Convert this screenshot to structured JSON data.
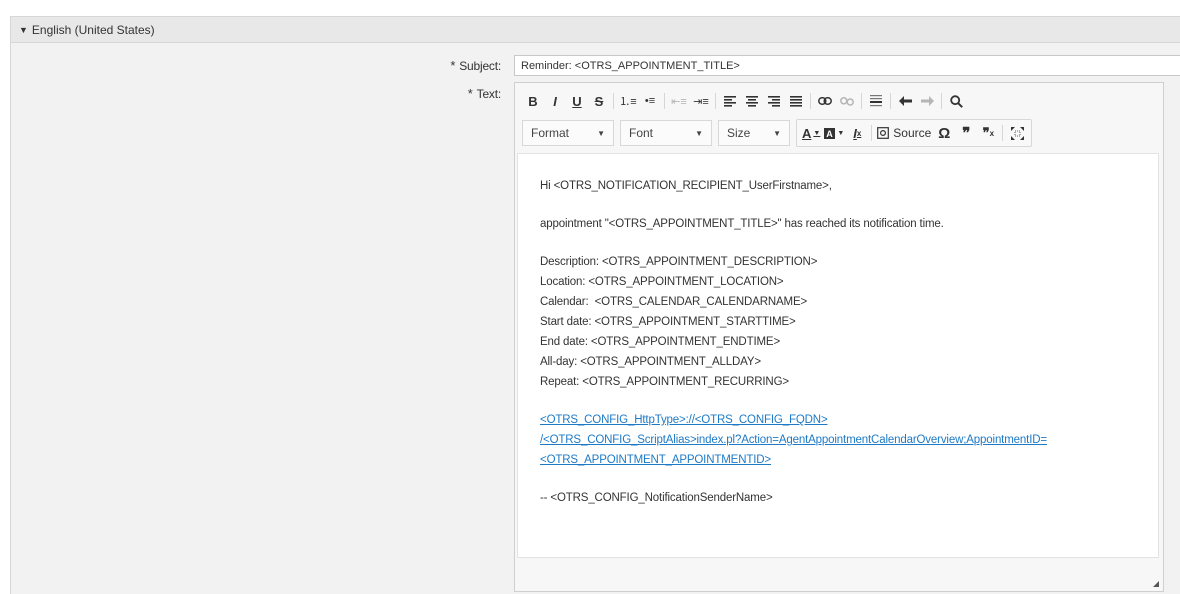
{
  "panel": {
    "title": "English (United States)"
  },
  "subject": {
    "label": "Subject:",
    "required_mark": "*",
    "value": "Reminder: <OTRS_APPOINTMENT_TITLE>"
  },
  "text_field": {
    "label": "Text:",
    "required_mark": "*"
  },
  "toolbar": {
    "format_label": "Format",
    "font_label": "Font",
    "size_label": "Size",
    "source_label": "Source",
    "icons": [
      "bold",
      "italic",
      "underline",
      "strikethrough",
      "numbered-list",
      "bulleted-list",
      "decrease-indent",
      "increase-indent",
      "align-left",
      "align-center",
      "align-right",
      "justify",
      "link",
      "unlink",
      "horizontal-line",
      "undo",
      "redo",
      "find",
      "text-color",
      "background-color",
      "remove-format",
      "source",
      "special-character",
      "blockquote",
      "remove-quote",
      "maximize"
    ]
  },
  "body": {
    "greeting": "Hi <OTRS_NOTIFICATION_RECIPIENT_UserFirstname>,",
    "message": "appointment \"<OTRS_APPOINTMENT_TITLE>\" has reached its notification time.",
    "details": [
      "Description: <OTRS_APPOINTMENT_DESCRIPTION>",
      "Location: <OTRS_APPOINTMENT_LOCATION>",
      "Calendar:  <OTRS_CALENDAR_CALENDARNAME>",
      "Start date: <OTRS_APPOINTMENT_STARTTIME>",
      "End date: <OTRS_APPOINTMENT_ENDTIME>",
      "All-day: <OTRS_APPOINTMENT_ALLDAY>",
      "Repeat: <OTRS_APPOINTMENT_RECURRING>"
    ],
    "link_lines": [
      "<OTRS_CONFIG_HttpType>://<OTRS_CONFIG_FQDN>",
      "/<OTRS_CONFIG_ScriptAlias>index.pl?Action=AgentAppointmentCalendarOverview;AppointmentID=",
      "<OTRS_APPOINTMENT_APPOINTMENTID>"
    ],
    "signature": "-- <OTRS_CONFIG_NotificationSenderName>"
  },
  "colors": {
    "link": "#1e7ac6",
    "panel_bg": "#f2f2f2",
    "header_bg": "#e8e8e8"
  }
}
